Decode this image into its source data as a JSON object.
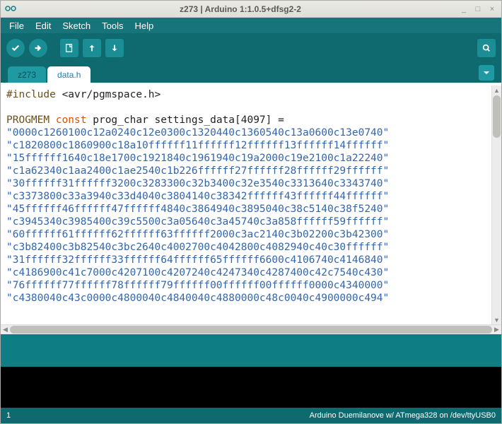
{
  "window": {
    "title": "z273 | Arduino 1:1.0.5+dfsg2-2"
  },
  "menu": {
    "file": "File",
    "edit": "Edit",
    "sketch": "Sketch",
    "tools": "Tools",
    "help": "Help"
  },
  "tabs": {
    "t0": "z273",
    "t1": "data.h"
  },
  "code": {
    "include_pre": "#include",
    "include_path": "<avr/pgmspace.h>",
    "decl_progmem": "PROGMEM",
    "decl_const": "const",
    "decl_rest": "prog_char settings_data[4097] =",
    "lines": [
      "\"0000c1260100c12a0240c12e0300c1320440c1360540c13a0600c13e0740\"",
      "\"c1820800c1860900c18a10ffffff11ffffff12ffffff13ffffff14ffffff\"",
      "\"15ffffff1640c18e1700c1921840c1961940c19a2000c19e2100c1a22240\"",
      "\"c1a62340c1aa2400c1ae2540c1b226ffffff27ffffff28ffffff29ffffff\"",
      "\"30ffffff31ffffff3200c3283300c32b3400c32e3540c3313640c3343740\"",
      "\"c3373800c33a3940c33d4040c3804140c38342ffffff43ffffff44ffffff\"",
      "\"45ffffff46ffffff47ffffff4840c3864940c3895040c38c5140c38f5240\"",
      "\"c3945340c3985400c39c5500c3a05640c3a45740c3a858ffffff59ffffff\"",
      "\"60ffffff61ffffff62ffffff63ffffff2000c3ac2140c3b02200c3b42300\"",
      "\"c3b82400c3b82540c3bc2640c4002700c4042800c4082940c40c30ffffff\"",
      "\"31ffffff32ffffff33ffffff64ffffff65ffffff6600c4106740c4146840\"",
      "\"c4186900c41c7000c4207100c4207240c4247340c4287400c42c7540c430\"",
      "\"76ffffff77ffffff78ffffff79ffffff00ffffff00ffffff0000c4340000\"",
      "\"c4380040c43c0000c4800040c4840040c4880000c48c0040c4900000c494\""
    ]
  },
  "footer": {
    "line": "1",
    "board": "Arduino Duemilanove w/ ATmega328 on /dev/ttyUSB0"
  }
}
